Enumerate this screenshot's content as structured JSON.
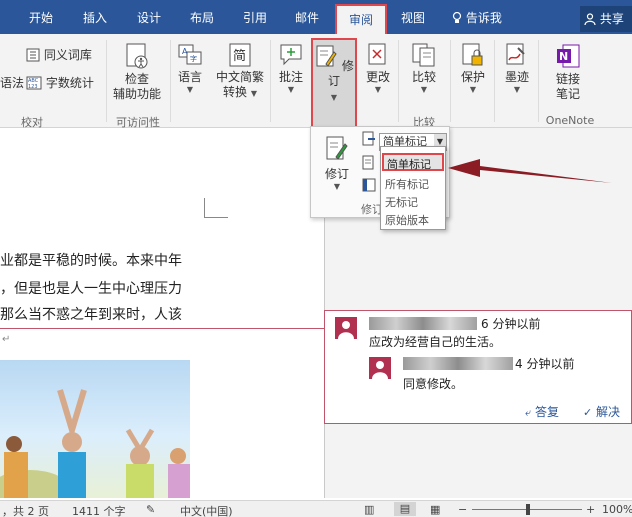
{
  "tabs": [
    "开始",
    "插入",
    "设计",
    "布局",
    "引用",
    "邮件",
    "审阅",
    "视图"
  ],
  "tell_me": "告诉我",
  "share": "共享",
  "ribbon": {
    "thesaurus": "同义词库",
    "grammar_fragment": "语法",
    "word_count": "字数统计",
    "group_proofing": "校对",
    "accessibility_line1": "检查",
    "accessibility_line2": "辅助功能",
    "group_accessibility": "可访问性",
    "language": "语言",
    "convert_line1": "中文简繁",
    "convert_line2": "转换",
    "comment": "批注",
    "track": "修订",
    "changes": "更改",
    "compare": "比较",
    "group_compare": "比较",
    "protect": "保护",
    "ink": "墨迹",
    "onenote_line1": "链接",
    "onenote_line2": "笔记",
    "group_onenote": "OneNote",
    "group_tracking": "修订"
  },
  "tracking_dropdown": {
    "current": "简单标记",
    "button": "修订",
    "options": [
      "简单标记",
      "所有标记",
      "无标记",
      "原始版本"
    ]
  },
  "doc": {
    "line1": "业都是平稳的时候。本来中年",
    "line2": "，但是也是人一生中心理压力",
    "line3": "那么当不惑之年到来时，人该"
  },
  "comments": [
    {
      "time": "6 分钟以前",
      "text": "应改为经营自己的生活。"
    },
    {
      "time": "4 分钟以前",
      "text": "同意修改。"
    }
  ],
  "comment_actions": {
    "reply": "答复",
    "resolve": "解决"
  },
  "status": {
    "pages": "，共 2 页",
    "words": "1411 个字",
    "language": "中文(中国)",
    "zoom": "100%"
  },
  "colors": {
    "brand": "#2b579a",
    "highlight": "#e0474c",
    "avatar": "#b12f4f",
    "arrow": "#8b1c24",
    "onenote": "#7719aa"
  }
}
